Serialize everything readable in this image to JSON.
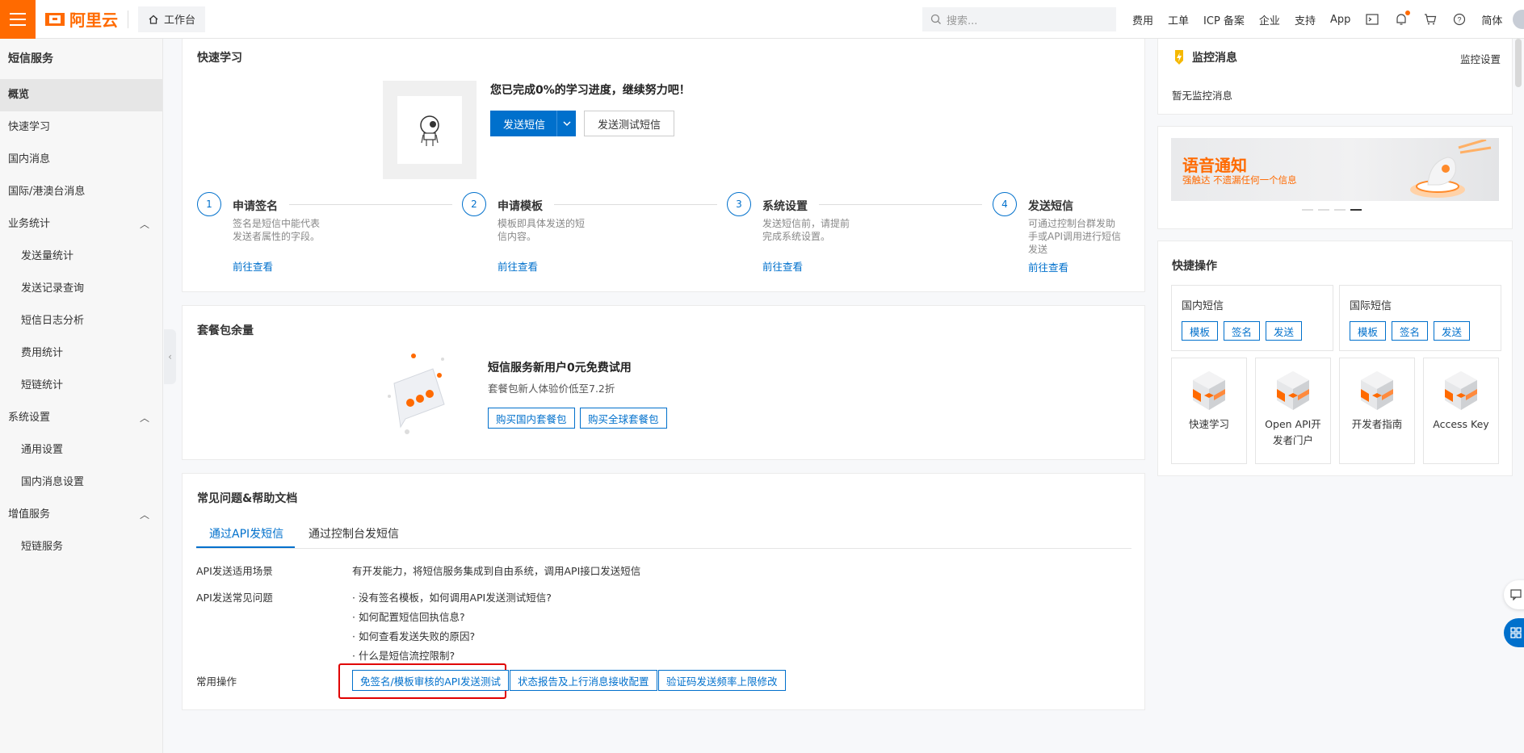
{
  "topbar": {
    "brand": "阿里云",
    "workbench": "工作台",
    "search_placeholder": "搜索...",
    "links": [
      "费用",
      "工单",
      "ICP 备案",
      "企业",
      "支持",
      "App"
    ],
    "lang": "简体"
  },
  "sidebar": {
    "title": "短信服务",
    "items": [
      {
        "label": "概览",
        "level": 0,
        "active": true
      },
      {
        "label": "快速学习",
        "level": 0
      },
      {
        "label": "国内消息",
        "level": 0
      },
      {
        "label": "国际/港澳台消息",
        "level": 0
      },
      {
        "label": "业务统计",
        "level": 0,
        "expanded": true
      },
      {
        "label": "发送量统计",
        "level": 1
      },
      {
        "label": "发送记录查询",
        "level": 1
      },
      {
        "label": "短信日志分析",
        "level": 1
      },
      {
        "label": "费用统计",
        "level": 1
      },
      {
        "label": "短链统计",
        "level": 1
      },
      {
        "label": "系统设置",
        "level": 0,
        "expanded": true
      },
      {
        "label": "通用设置",
        "level": 1
      },
      {
        "label": "国内消息设置",
        "level": 1
      },
      {
        "label": "增值服务",
        "level": 0,
        "expanded": true
      },
      {
        "label": "短链服务",
        "level": 1
      }
    ]
  },
  "learn": {
    "title": "快速学习",
    "progress_text": "您已完成0%的学习进度，继续努力吧！",
    "progress_percent": 0,
    "send_btn": "发送短信",
    "test_btn": "发送测试短信",
    "steps": [
      {
        "num": "1",
        "title": "申请签名",
        "desc": "签名是短信中能代表发送者属性的字段。",
        "link": "前往查看"
      },
      {
        "num": "2",
        "title": "申请模板",
        "desc": "模板即具体发送的短信内容。",
        "link": "前往查看"
      },
      {
        "num": "3",
        "title": "系统设置",
        "desc": "发送短信前，请提前完成系统设置。",
        "link": "前往查看"
      },
      {
        "num": "4",
        "title": "发送短信",
        "desc": "可通过控制台群发助手或API调用进行短信发送",
        "link": "前往查看"
      }
    ]
  },
  "package": {
    "title": "套餐包余量",
    "headline": "短信服务新用户0元免费试用",
    "sub": "套餐包新人体验价低至7.2折",
    "btn_domestic": "购买国内套餐包",
    "btn_global": "购买全球套餐包"
  },
  "faq": {
    "title": "常见问题&帮助文档",
    "tabs": [
      "通过API发短信",
      "通过控制台发短信"
    ],
    "scene_label": "API发送适用场景",
    "scene_text": "有开发能力，将短信服务集成到自由系统，调用API接口发送短信",
    "questions_label": "API发送常见问题",
    "questions": [
      "没有签名模板，如何调用API发送测试短信?",
      "如何配置短信回执信息?",
      "如何查看发送失败的原因?",
      "什么是短信流控限制?"
    ],
    "ops_label": "常用操作",
    "ops": [
      "免签名/模板审核的API发送测试",
      "状态报告及上行消息接收配置",
      "验证码发送频率上限修改"
    ]
  },
  "monitor": {
    "title": "监控消息",
    "settings": "监控设置",
    "empty": "暂无监控消息"
  },
  "banner": {
    "title": "语音通知",
    "sub": "强触达 不遗漏任何一个信息",
    "slides": 4,
    "active_slide": 4
  },
  "quick_ops": {
    "title": "快捷操作",
    "domestic": {
      "title": "国内短信",
      "btns": [
        "模板",
        "签名",
        "发送"
      ]
    },
    "international": {
      "title": "国际短信",
      "btns": [
        "模板",
        "签名",
        "发送"
      ]
    },
    "tiles": [
      "快速学习",
      "Open API开发者门户",
      "开发者指南",
      "Access Key"
    ]
  },
  "colors": {
    "accent": "#ff6a00",
    "primary": "#0070cc",
    "highlight": "#e00000"
  }
}
